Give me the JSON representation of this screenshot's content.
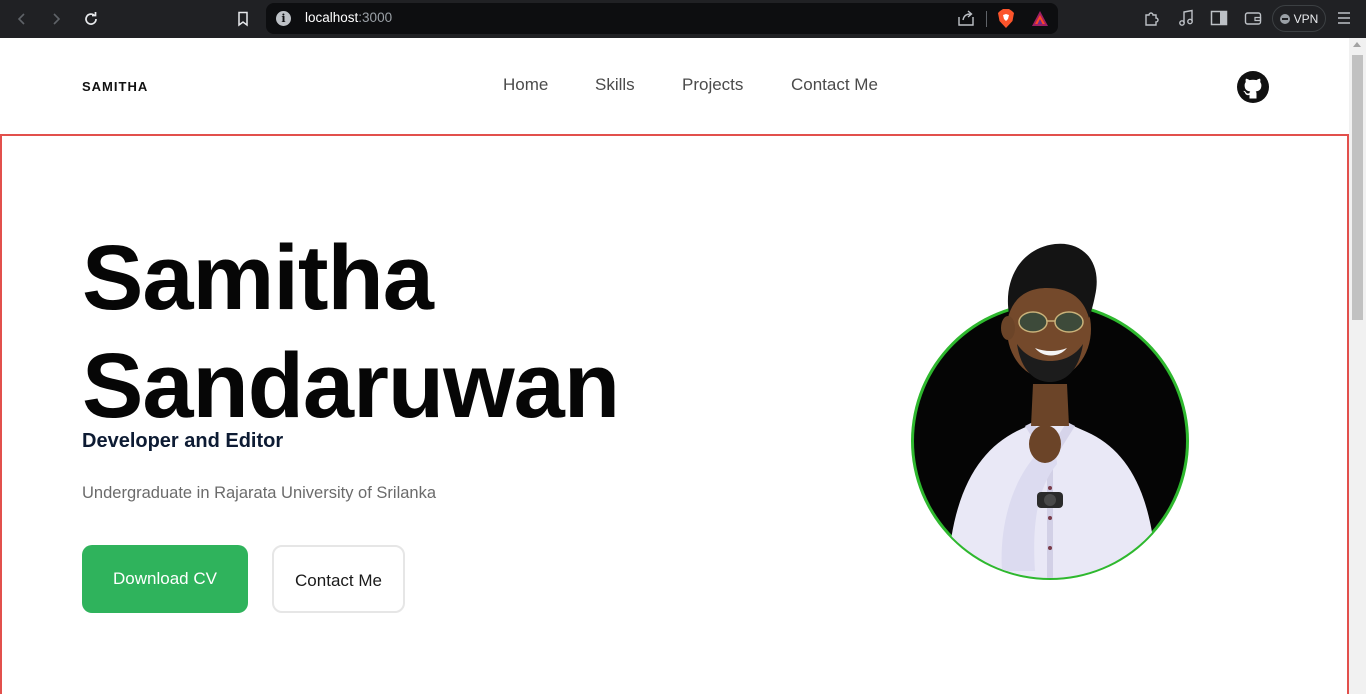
{
  "browser": {
    "url_host": "localhost",
    "url_port": ":3000",
    "vpn_label": "VPN"
  },
  "site": {
    "logo": "SAMITHA",
    "nav": [
      "Home",
      "Skills",
      "Projects",
      "Contact Me"
    ]
  },
  "hero": {
    "name_line1": "Samitha",
    "name_line2": "Sandaruwan",
    "role": "Developer and Editor",
    "subtitle": "Undergraduate in Rajarata University of Srilanka",
    "download_cv": "Download CV",
    "contact_me": "Contact Me"
  },
  "colors": {
    "accent_green": "#2fb35c",
    "hero_border": "#e2504c",
    "avatar_ring": "#2eb82e"
  }
}
